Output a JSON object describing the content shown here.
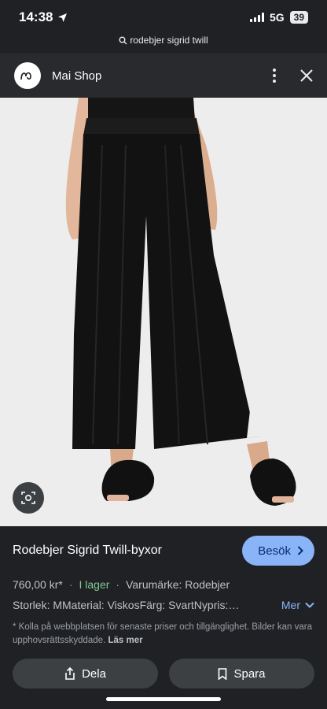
{
  "status": {
    "time": "14:38",
    "network": "5G",
    "battery": "39"
  },
  "search": {
    "query": "rodebjer sigrid twill"
  },
  "header": {
    "shop_name": "Mai Shop"
  },
  "product": {
    "title": "Rodebjer Sigrid Twill-byxor",
    "price": "760,00 kr*",
    "stock": "I lager",
    "brand": "Varumärke: Rodebjer",
    "attributes": "Storlek: MMaterial: ViskosFärg: SvartNypris:…",
    "more_label": "Mer",
    "visit_label": "Besök",
    "disclaimer": "* Kolla på webbplatsen för senaste priser och tillgänglighet. Bilder kan vara upphovsrättsskyddade.",
    "read_more": "Läs mer"
  },
  "actions": {
    "share_label": "Dela",
    "save_label": "Spara"
  },
  "colors": {
    "accent": "#8ab4f8",
    "in_stock": "#81c995",
    "background": "#202124"
  }
}
